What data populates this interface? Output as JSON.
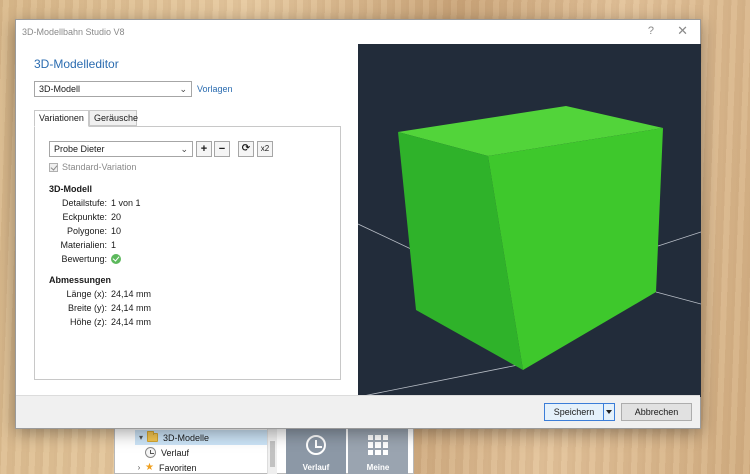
{
  "window": {
    "title": "3D-Modellbahn Studio V8",
    "help": "?",
    "close": "✕"
  },
  "editor": {
    "title": "3D-Modelleditor",
    "model_select": "3D-Modell",
    "templates_link": "Vorlagen",
    "tabs": [
      {
        "label": "Variationen",
        "active": true
      },
      {
        "label": "Geräusche",
        "active": false
      }
    ],
    "variation_select": "Probe Dieter",
    "buttons": {
      "add": "+",
      "remove": "−",
      "refresh": "⟳",
      "double": "x2"
    },
    "standard_variation": "Standard-Variation",
    "model_section": {
      "heading": "3D-Modell",
      "rows": [
        {
          "label": "Detailstufe:",
          "value": "1 von 1"
        },
        {
          "label": "Eckpunkte:",
          "value": "20"
        },
        {
          "label": "Polygone:",
          "value": "10"
        },
        {
          "label": "Materialien:",
          "value": "1"
        },
        {
          "label": "Bewertung:",
          "value": ""
        }
      ]
    },
    "dimensions_section": {
      "heading": "Abmessungen",
      "rows": [
        {
          "label": "Länge (x):",
          "value": "24,14 mm"
        },
        {
          "label": "Breite (y):",
          "value": "24,14 mm"
        },
        {
          "label": "Höhe (z):",
          "value": "24,14 mm"
        }
      ]
    }
  },
  "viewport": {
    "background": "#222c3a",
    "cube_colors": {
      "top": "#52d43a",
      "front": "#3ec82c",
      "side": "#2fb22a"
    }
  },
  "footer": {
    "save": "Speichern",
    "cancel": "Abbrechen"
  },
  "background_app": {
    "tree": [
      {
        "label": "3D-Modelle"
      },
      {
        "label": "Verlauf"
      },
      {
        "label": "Favoriten"
      }
    ],
    "tiles": [
      {
        "label": "Verlauf"
      },
      {
        "label": "Meine"
      }
    ]
  }
}
